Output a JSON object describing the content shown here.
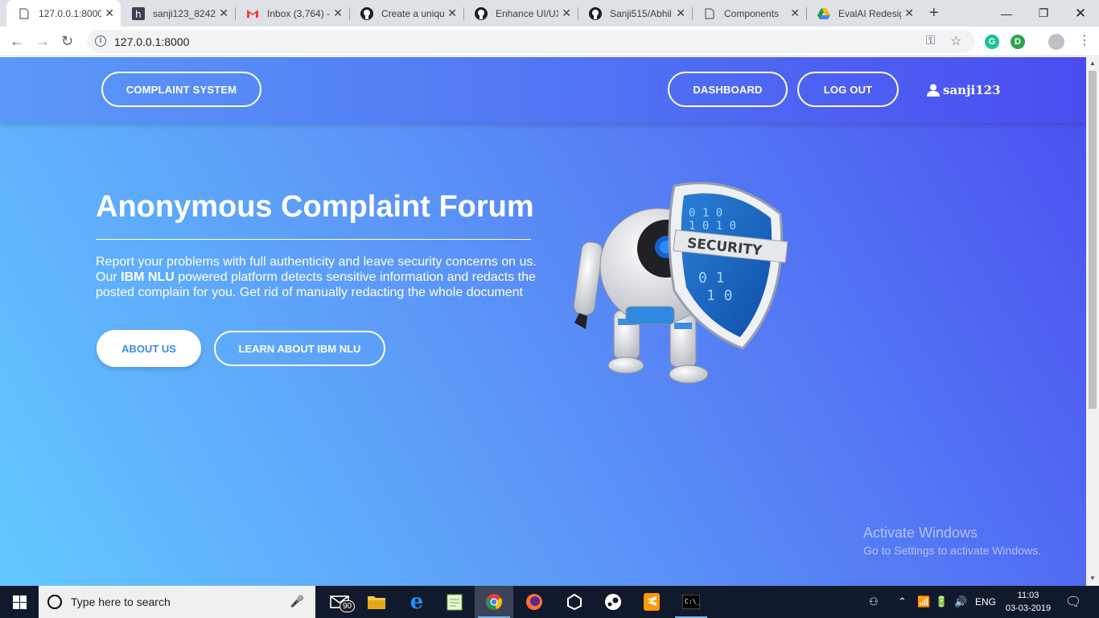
{
  "browser": {
    "tabs": [
      {
        "title": "127.0.0.1:8000",
        "icon": "page-icon",
        "active": true
      },
      {
        "title": "sanji123_8242",
        "icon": "hackerrank-icon",
        "active": false
      },
      {
        "title": "Inbox (3,764) -",
        "icon": "gmail-icon",
        "active": false
      },
      {
        "title": "Create a uniqu",
        "icon": "github-icon",
        "active": false
      },
      {
        "title": "Enhance UI/UX",
        "icon": "github-icon",
        "active": false
      },
      {
        "title": "Sanji515/Abhil",
        "icon": "github-icon",
        "active": false
      },
      {
        "title": "Components",
        "icon": "page-icon",
        "active": false
      },
      {
        "title": "EvalAI Redesig",
        "icon": "drive-icon",
        "active": false
      }
    ],
    "url": "127.0.0.1:8000"
  },
  "navbar": {
    "brand": "COMPLAINT SYSTEM",
    "dashboard": "DASHBOARD",
    "logout": "LOG OUT",
    "username": "sanji123"
  },
  "hero": {
    "title": "Anonymous Complaint Forum",
    "text_before": "Report your problems with full authenticity and leave security concerns on us. Our ",
    "text_bold": "IBM NLU",
    "text_after": " powered platform detects sensitive information and redacts the posted complain for you. Get rid of manually redacting the whole document",
    "about_btn": "ABOUT US",
    "learn_btn": "LEARN ABOUT IBM NLU",
    "shield_text": "SECURITY"
  },
  "watermark": {
    "line1": "Activate Windows",
    "line2": "Go to Settings to activate Windows."
  },
  "taskbar": {
    "search_placeholder": "Type here to search",
    "mail_badge": "90",
    "language": "ENG",
    "time": "11:03",
    "date": "03-03-2019"
  },
  "colors": {
    "accent": "#3a8be8",
    "gradient_start": "#63c8ff",
    "gradient_end": "#4a4ff0"
  }
}
